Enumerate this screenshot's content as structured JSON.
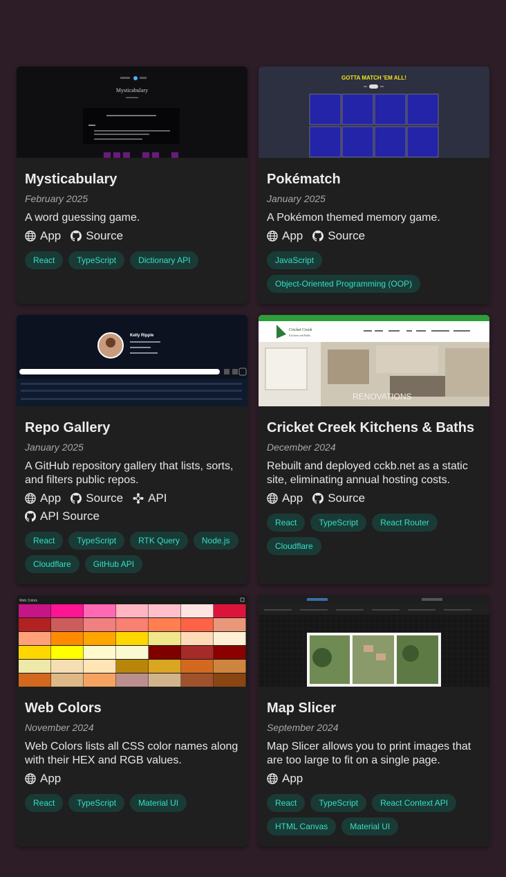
{
  "projects": [
    {
      "title": "Mysticabulary",
      "date": "February 2025",
      "description": "A word guessing game.",
      "links": [
        "App",
        "Source"
      ],
      "tags": [
        "React",
        "TypeScript",
        "Dictionary API"
      ],
      "thumb": {
        "heading": "Mysticabulary"
      }
    },
    {
      "title": "Pokématch",
      "date": "January 2025",
      "description": "A Pokémon themed memory game.",
      "links": [
        "App",
        "Source"
      ],
      "tags": [
        "JavaScript",
        "Object-Oriented Programming (OOP)"
      ],
      "thumb": {
        "heading": "GOTTA MATCH 'EM ALL!"
      }
    },
    {
      "title": "Repo Gallery",
      "date": "January 2025",
      "description": "A GitHub repository gallery that lists, sorts, and filters public repos.",
      "links": [
        "App",
        "Source",
        "API",
        "API Source"
      ],
      "tags": [
        "React",
        "TypeScript",
        "RTK Query",
        "Node.js",
        "Cloudflare",
        "GitHub API"
      ],
      "thumb": {
        "heading": "Kelly Ripple"
      }
    },
    {
      "title": "Cricket Creek Kitchens & Baths",
      "date": "December 2024",
      "description": "Rebuilt and deployed cckb.net as a static site, eliminating annual hosting costs.",
      "links": [
        "App",
        "Source"
      ],
      "tags": [
        "React",
        "TypeScript",
        "React Router",
        "Cloudflare"
      ],
      "thumb": {
        "heading": "Cricket Creek",
        "subheading": "Kitchens and Baths",
        "overlay": "RENOVATIONS"
      }
    },
    {
      "title": "Web Colors",
      "date": "November 2024",
      "description": "Web Colors lists all CSS color names along with their HEX and RGB values.",
      "links": [
        "App"
      ],
      "tags": [
        "React",
        "TypeScript",
        "Material UI"
      ],
      "thumb": {
        "heading": "Web Colors"
      }
    },
    {
      "title": "Map Slicer",
      "date": "September 2024",
      "description": "Map Slicer allows you to print images that are too large to fit on a single page.",
      "links": [
        "App"
      ],
      "tags": [
        "React",
        "TypeScript",
        "React Context API",
        "HTML Canvas",
        "Material UI"
      ],
      "thumb": {}
    }
  ],
  "colors": {
    "background": "#2c1d27",
    "card": "#1f1f1f",
    "tag_bg": "#1a3a36",
    "tag_text": "#34e0c4"
  }
}
